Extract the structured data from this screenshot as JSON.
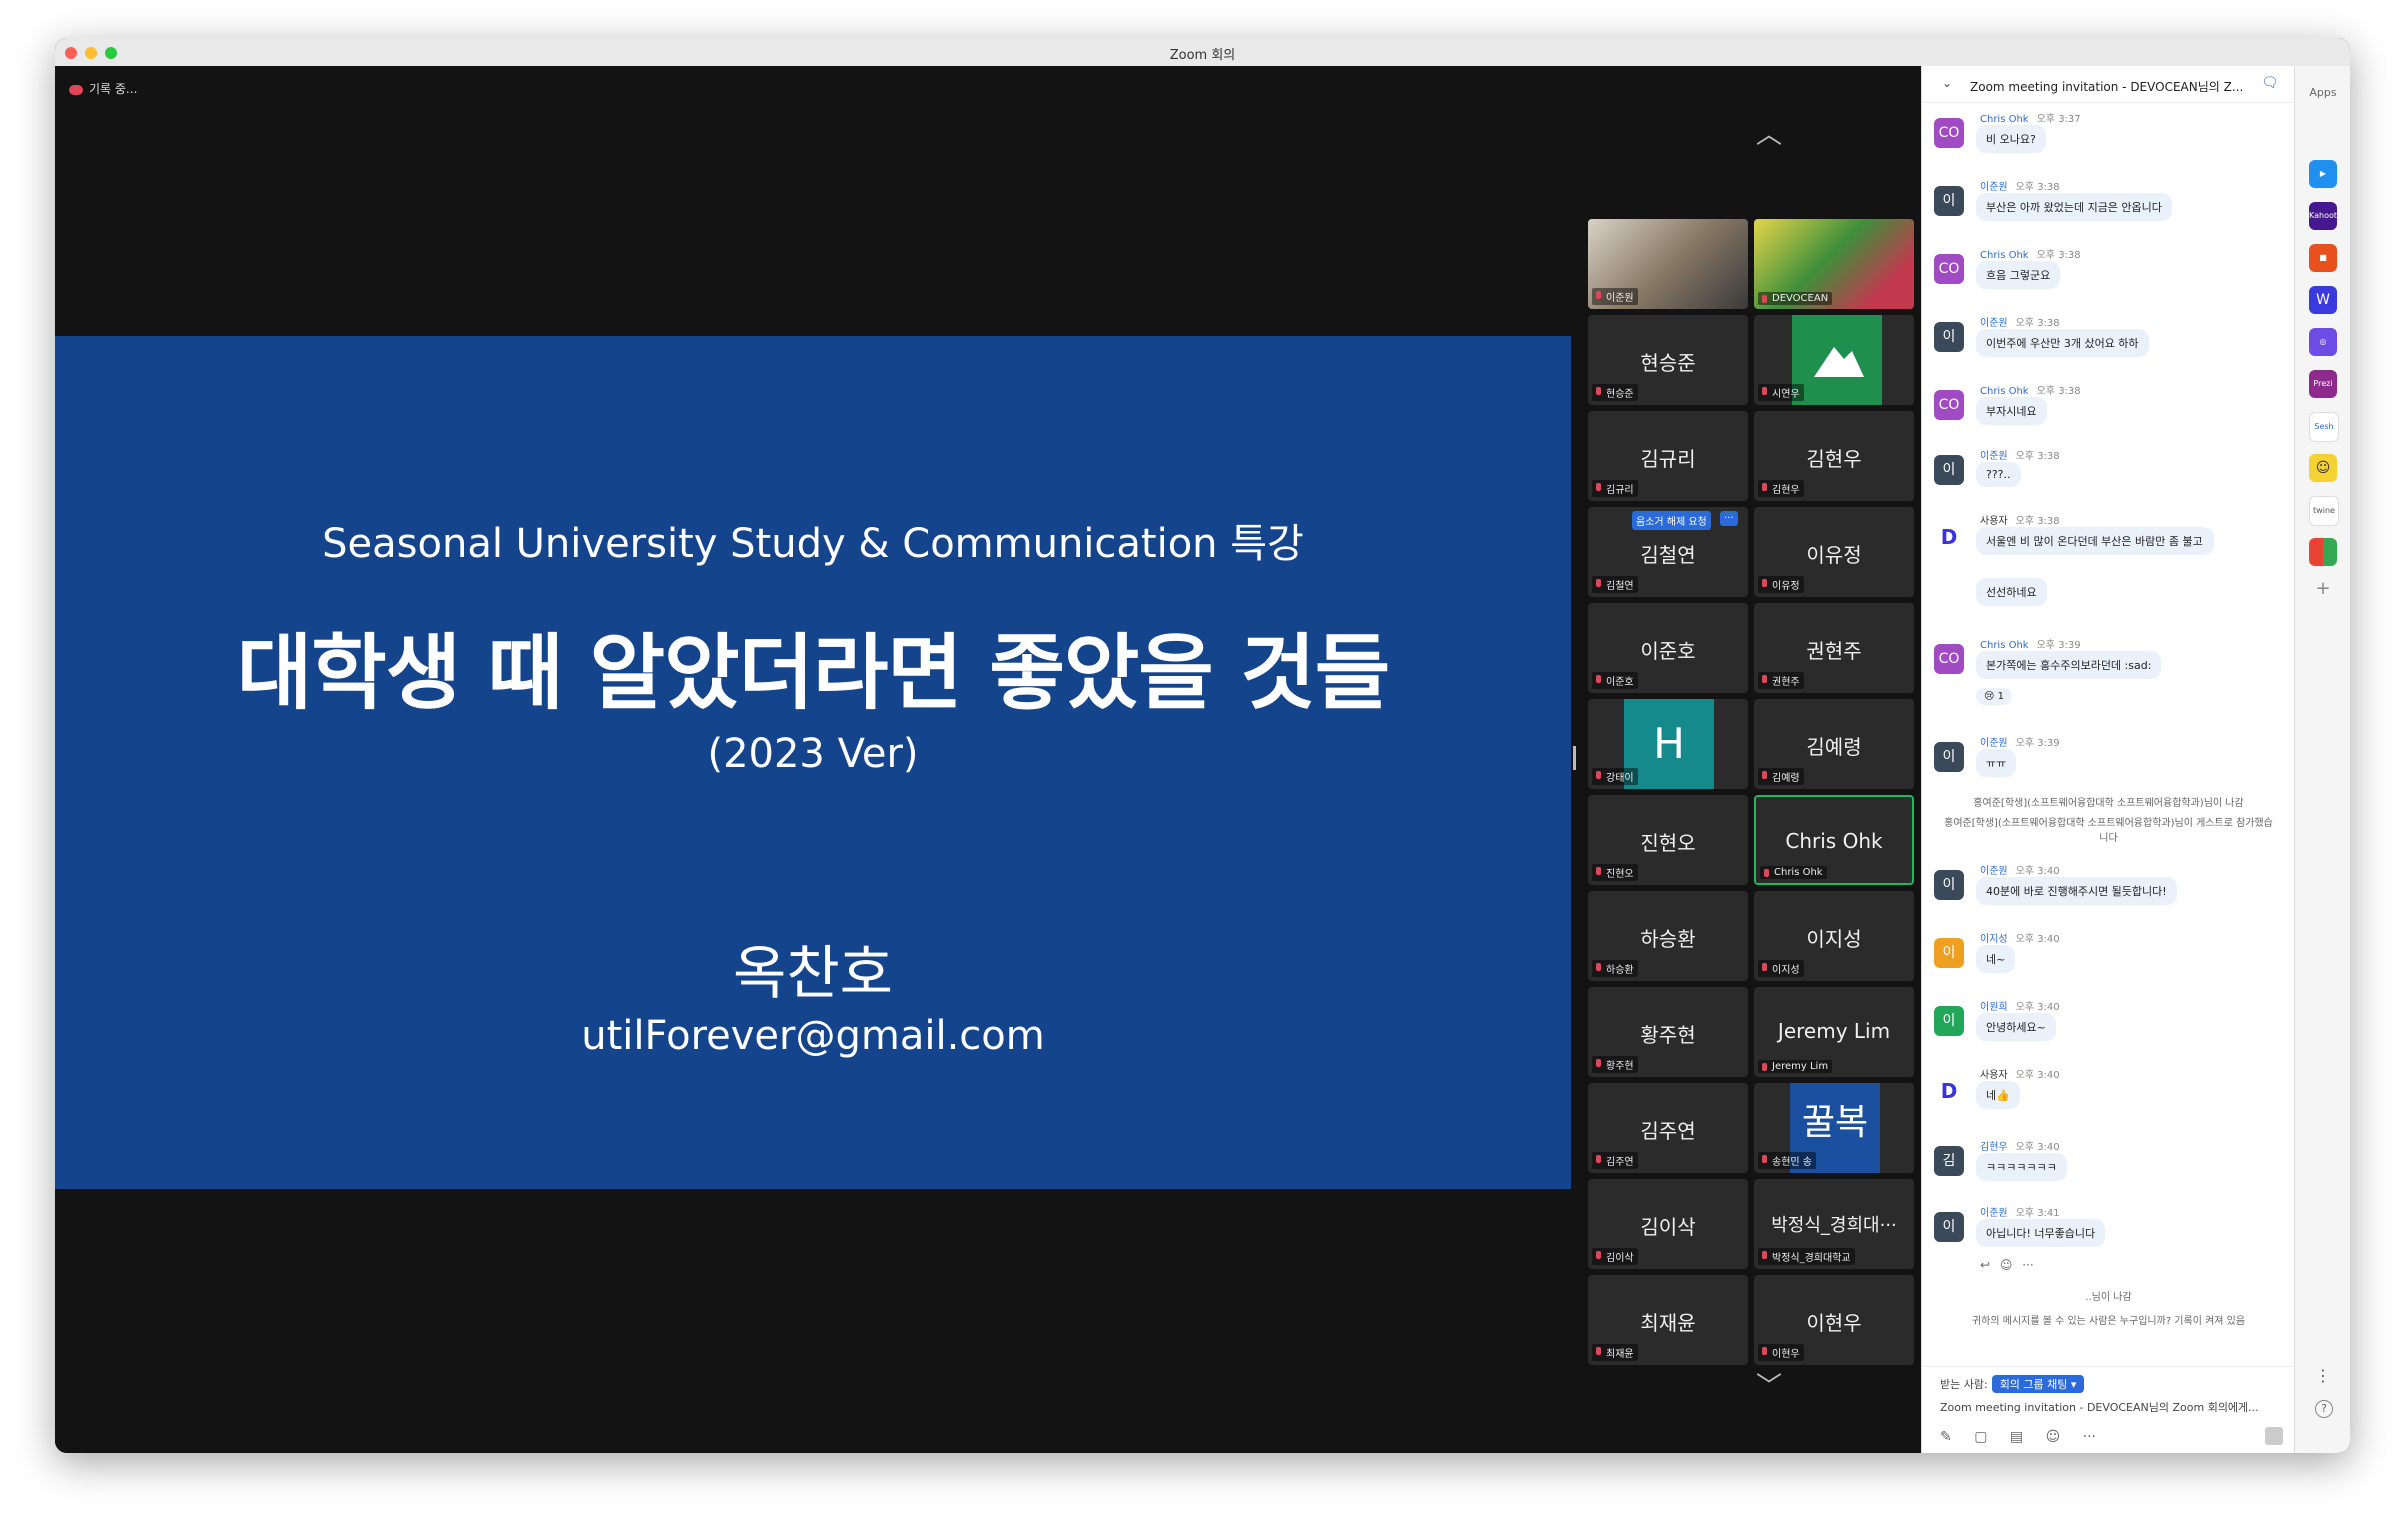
{
  "window": {
    "title": "Zoom 회의",
    "traffic": {
      "red": "#ff5f57",
      "yellow": "#febc2e",
      "green": "#28c840"
    }
  },
  "recording": {
    "label": "기록 중..."
  },
  "slide": {
    "subtitle": "Seasonal University Study & Communication 특강",
    "title": "대학생 때 알았더라면 좋았을 것들",
    "version": "(2023 Ver)",
    "presenter": "옥찬호",
    "email": "utilForever@gmail.com",
    "background": "#14448c"
  },
  "gallery": {
    "request_badge": "음소거 해제 요청",
    "more_badge": "···",
    "tiles": [
      {
        "name": "이준원",
        "label": "이준원"
      },
      {
        "name": "DEVOCEAN",
        "label": "DEVOCEAN"
      },
      {
        "name": "현승준",
        "label": "현승준"
      },
      {
        "name": "시연우",
        "label": "시연우"
      },
      {
        "name": "김규리",
        "label": "김규리"
      },
      {
        "name": "김현우",
        "label": "김현우"
      },
      {
        "name": "김철연",
        "label": "김철연"
      },
      {
        "name": "이유정",
        "label": "이유정"
      },
      {
        "name": "이준호",
        "label": "이준호"
      },
      {
        "name": "권현주",
        "label": "권현주"
      },
      {
        "name": "H",
        "label": "강태이"
      },
      {
        "name": "김예령",
        "label": "김예령"
      },
      {
        "name": "진현오",
        "label": "진현오"
      },
      {
        "name": "Chris Ohk",
        "label": "Chris Ohk"
      },
      {
        "name": "하승환",
        "label": "하승환"
      },
      {
        "name": "이지성",
        "label": "이지성"
      },
      {
        "name": "황주현",
        "label": "황주현"
      },
      {
        "name": "Jeremy Lim",
        "label": "Jeremy Lim"
      },
      {
        "name": "김주연",
        "label": "김주연"
      },
      {
        "name": "꿀복",
        "label": "송현민 송"
      },
      {
        "name": "김이삭",
        "label": "김이삭"
      },
      {
        "name": "박정식_경희대···",
        "label": "박정식_경희대학교"
      },
      {
        "name": "최재윤",
        "label": "최재윤"
      },
      {
        "name": "이현우",
        "label": "이현우"
      }
    ]
  },
  "chat": {
    "header": "Zoom meeting invitation - DEVOCEAN님의 Z...",
    "messages": [
      {
        "avatar": "CO",
        "sender": "Chris Ohk",
        "time": "오후 3:37",
        "text": "비 오나요?"
      },
      {
        "avatar": "이",
        "sender": "이준원",
        "time": "오후 3:38",
        "text": "부산은 아까 왔었는데 지금은 안옵니다"
      },
      {
        "avatar": "CO",
        "sender": "Chris Ohk",
        "time": "오후 3:38",
        "text": "흐음 그렇군요"
      },
      {
        "avatar": "이",
        "sender": "이준원",
        "time": "오후 3:38",
        "text": "이번주에 우산만 3개 샀어요 하하"
      },
      {
        "avatar": "CO",
        "sender": "Chris Ohk",
        "time": "오후 3:38",
        "text": "부자시네요"
      },
      {
        "avatar": "이",
        "sender": "이준원",
        "time": "오후 3:38",
        "text": "???.."
      },
      {
        "avatar": "D",
        "sender": "사용자",
        "time": "오후 3:38",
        "text": "서울엔 비 많이 온다던데 부산은 바람만 좀 불고",
        "text2": "선선하네요"
      },
      {
        "avatar": "CO",
        "sender": "Chris Ohk",
        "time": "오후 3:39",
        "text": "본가쪽에는 홍수주의보라던데 :sad:",
        "reaction": "😢 1"
      },
      {
        "avatar": "이",
        "sender": "이준원",
        "time": "오후 3:39",
        "text": "ㅠㅠ"
      },
      {
        "avatar": "이",
        "sender": "이준원",
        "time": "오후 3:40",
        "text": "40분에 바로 진행해주시면 될듯합니다!"
      },
      {
        "avatar": "이",
        "sender": "이지성",
        "time": "오후 3:40",
        "text": "네~"
      },
      {
        "avatar": "이",
        "sender": "이원희",
        "time": "오후 3:40",
        "text": "안녕하세요~"
      },
      {
        "avatar": "D",
        "sender": "사용자",
        "time": "오후 3:40",
        "text": "네👍"
      },
      {
        "avatar": "김",
        "sender": "김현우",
        "time": "오후 3:40",
        "text": "ㅋㅋㅋㅋㅋㅋㅋ"
      },
      {
        "avatar": "이",
        "sender": "이준원",
        "time": "오후 3:41",
        "text": "아닙니다! 너무좋습니다"
      }
    ],
    "system": {
      "left1": "홍여준[학생](소프트웨어융합대학 소프트웨어융합학과)님이 나감",
      "left2": "홍여준[학생](소프트웨어융합대학 소프트웨어융합학과)님이 게스트로 참가했습니다",
      "left3": "..님이 나감",
      "privacy": "귀하의 메시지를 볼 수 있는 사람은 누구입니까? 기록이 켜져 있음"
    },
    "to_label": "받는 사람:",
    "to_value": "회의 그룹 채팅 ▾",
    "draft": "Zoom meeting invitation - DEVOCEAN님의 Zoom 회의에게..."
  },
  "apps": {
    "header": "Apps",
    "items": [
      "Kahoot!",
      "Prezi",
      "Sesh",
      "twine"
    ]
  }
}
